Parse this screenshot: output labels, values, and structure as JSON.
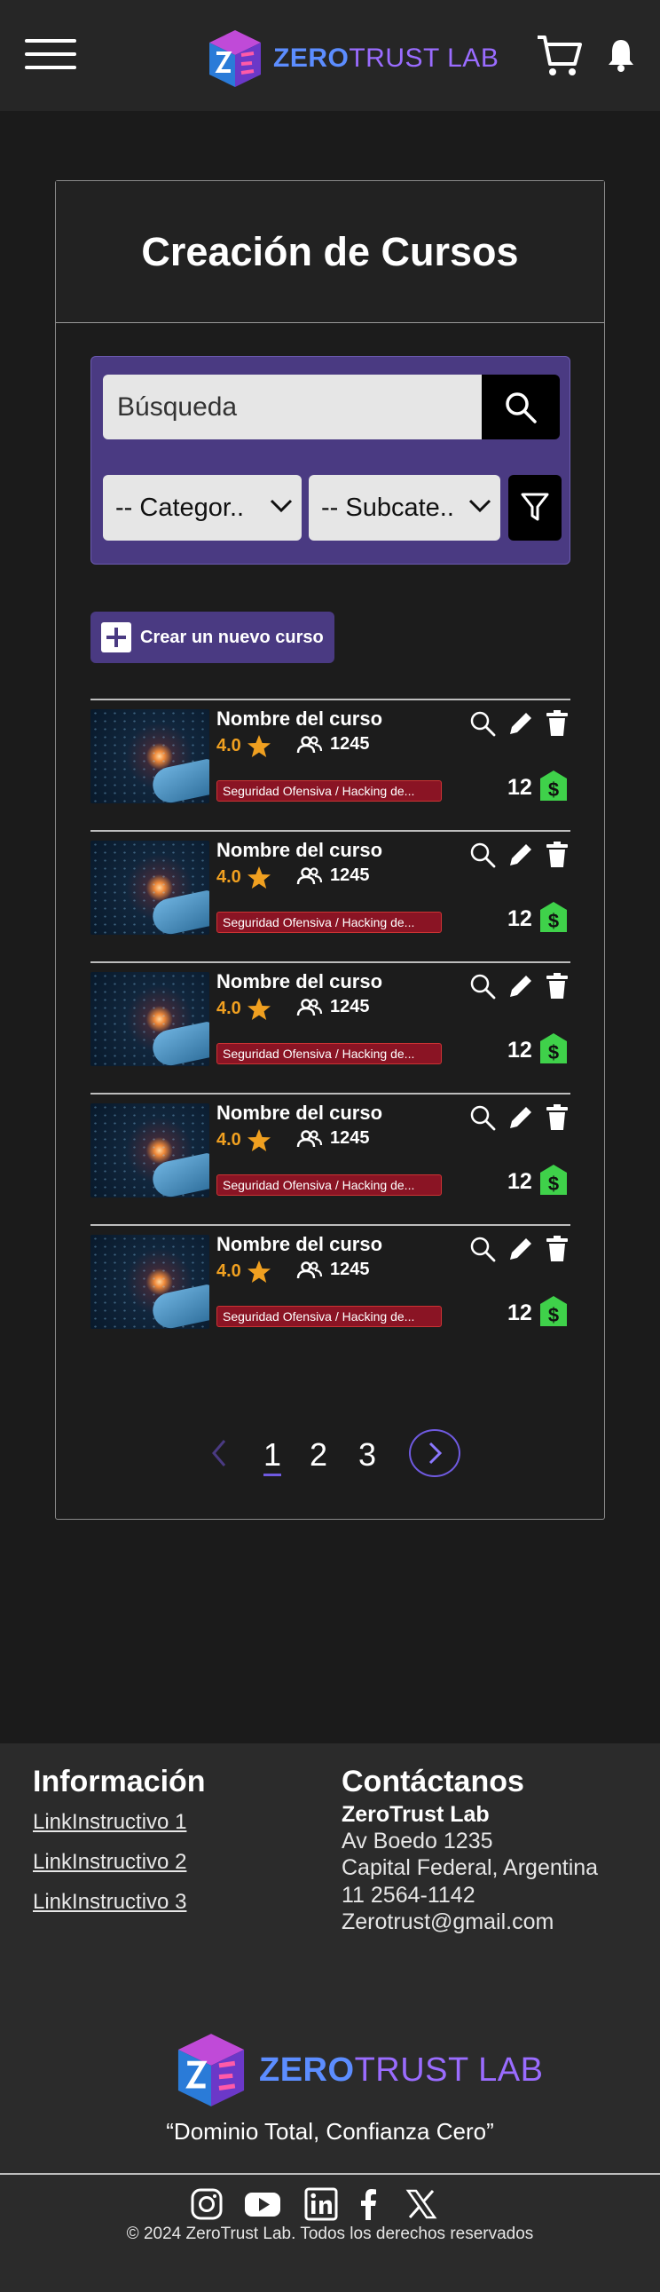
{
  "header": {
    "logo": {
      "zero": "ZERO",
      "trust": "TRUST LAB"
    },
    "icons": [
      "hamburger-menu-icon",
      "cart-icon",
      "bell-icon"
    ]
  },
  "panel": {
    "title": "Creación de Cursos",
    "search": {
      "placeholder": "Búsqueda"
    },
    "filters": {
      "category": "-- Categor..",
      "subcategory": "-- Subcate.."
    },
    "create_button": "Crear un nuevo curso"
  },
  "courses": [
    {
      "name": "Nombre del curso",
      "rating": "4.0",
      "students": "1245",
      "tag": "Seguridad Ofensiva / Hacking de...",
      "price": "12"
    },
    {
      "name": "Nombre del curso",
      "rating": "4.0",
      "students": "1245",
      "tag": "Seguridad Ofensiva / Hacking de...",
      "price": "12"
    },
    {
      "name": "Nombre del curso",
      "rating": "4.0",
      "students": "1245",
      "tag": "Seguridad Ofensiva / Hacking de...",
      "price": "12"
    },
    {
      "name": "Nombre del curso",
      "rating": "4.0",
      "students": "1245",
      "tag": "Seguridad Ofensiva / Hacking de...",
      "price": "12"
    },
    {
      "name": "Nombre del curso",
      "rating": "4.0",
      "students": "1245",
      "tag": "Seguridad Ofensiva / Hacking de...",
      "price": "12"
    }
  ],
  "pagination": {
    "pages": [
      "1",
      "2",
      "3"
    ],
    "current": "1"
  },
  "footer": {
    "info_title": "Información",
    "links": [
      "LinkInstructivo 1",
      "LinkInstructivo 2",
      "LinkInstructivo 3"
    ],
    "contact_title": "Contáctanos",
    "contact": {
      "company": "ZeroTrust Lab",
      "address": "Av Boedo 1235",
      "city": "Capital Federal, Argentina",
      "phone": "11 2564-1142",
      "email": "Zerotrust@gmail.com"
    },
    "tagline": "“Dominio Total, Confianza Cero”",
    "social": [
      "instagram-icon",
      "youtube-icon",
      "linkedin-icon",
      "facebook-icon",
      "x-icon"
    ],
    "copyright": "© 2024 ZeroTrust Lab. Todos los derechos reservados"
  },
  "colors": {
    "accent": "#4a3a82",
    "accent_border": "#6f5ae0",
    "rating": "#f0a020",
    "tag": "#8a1424",
    "price": "#3fd14a"
  }
}
